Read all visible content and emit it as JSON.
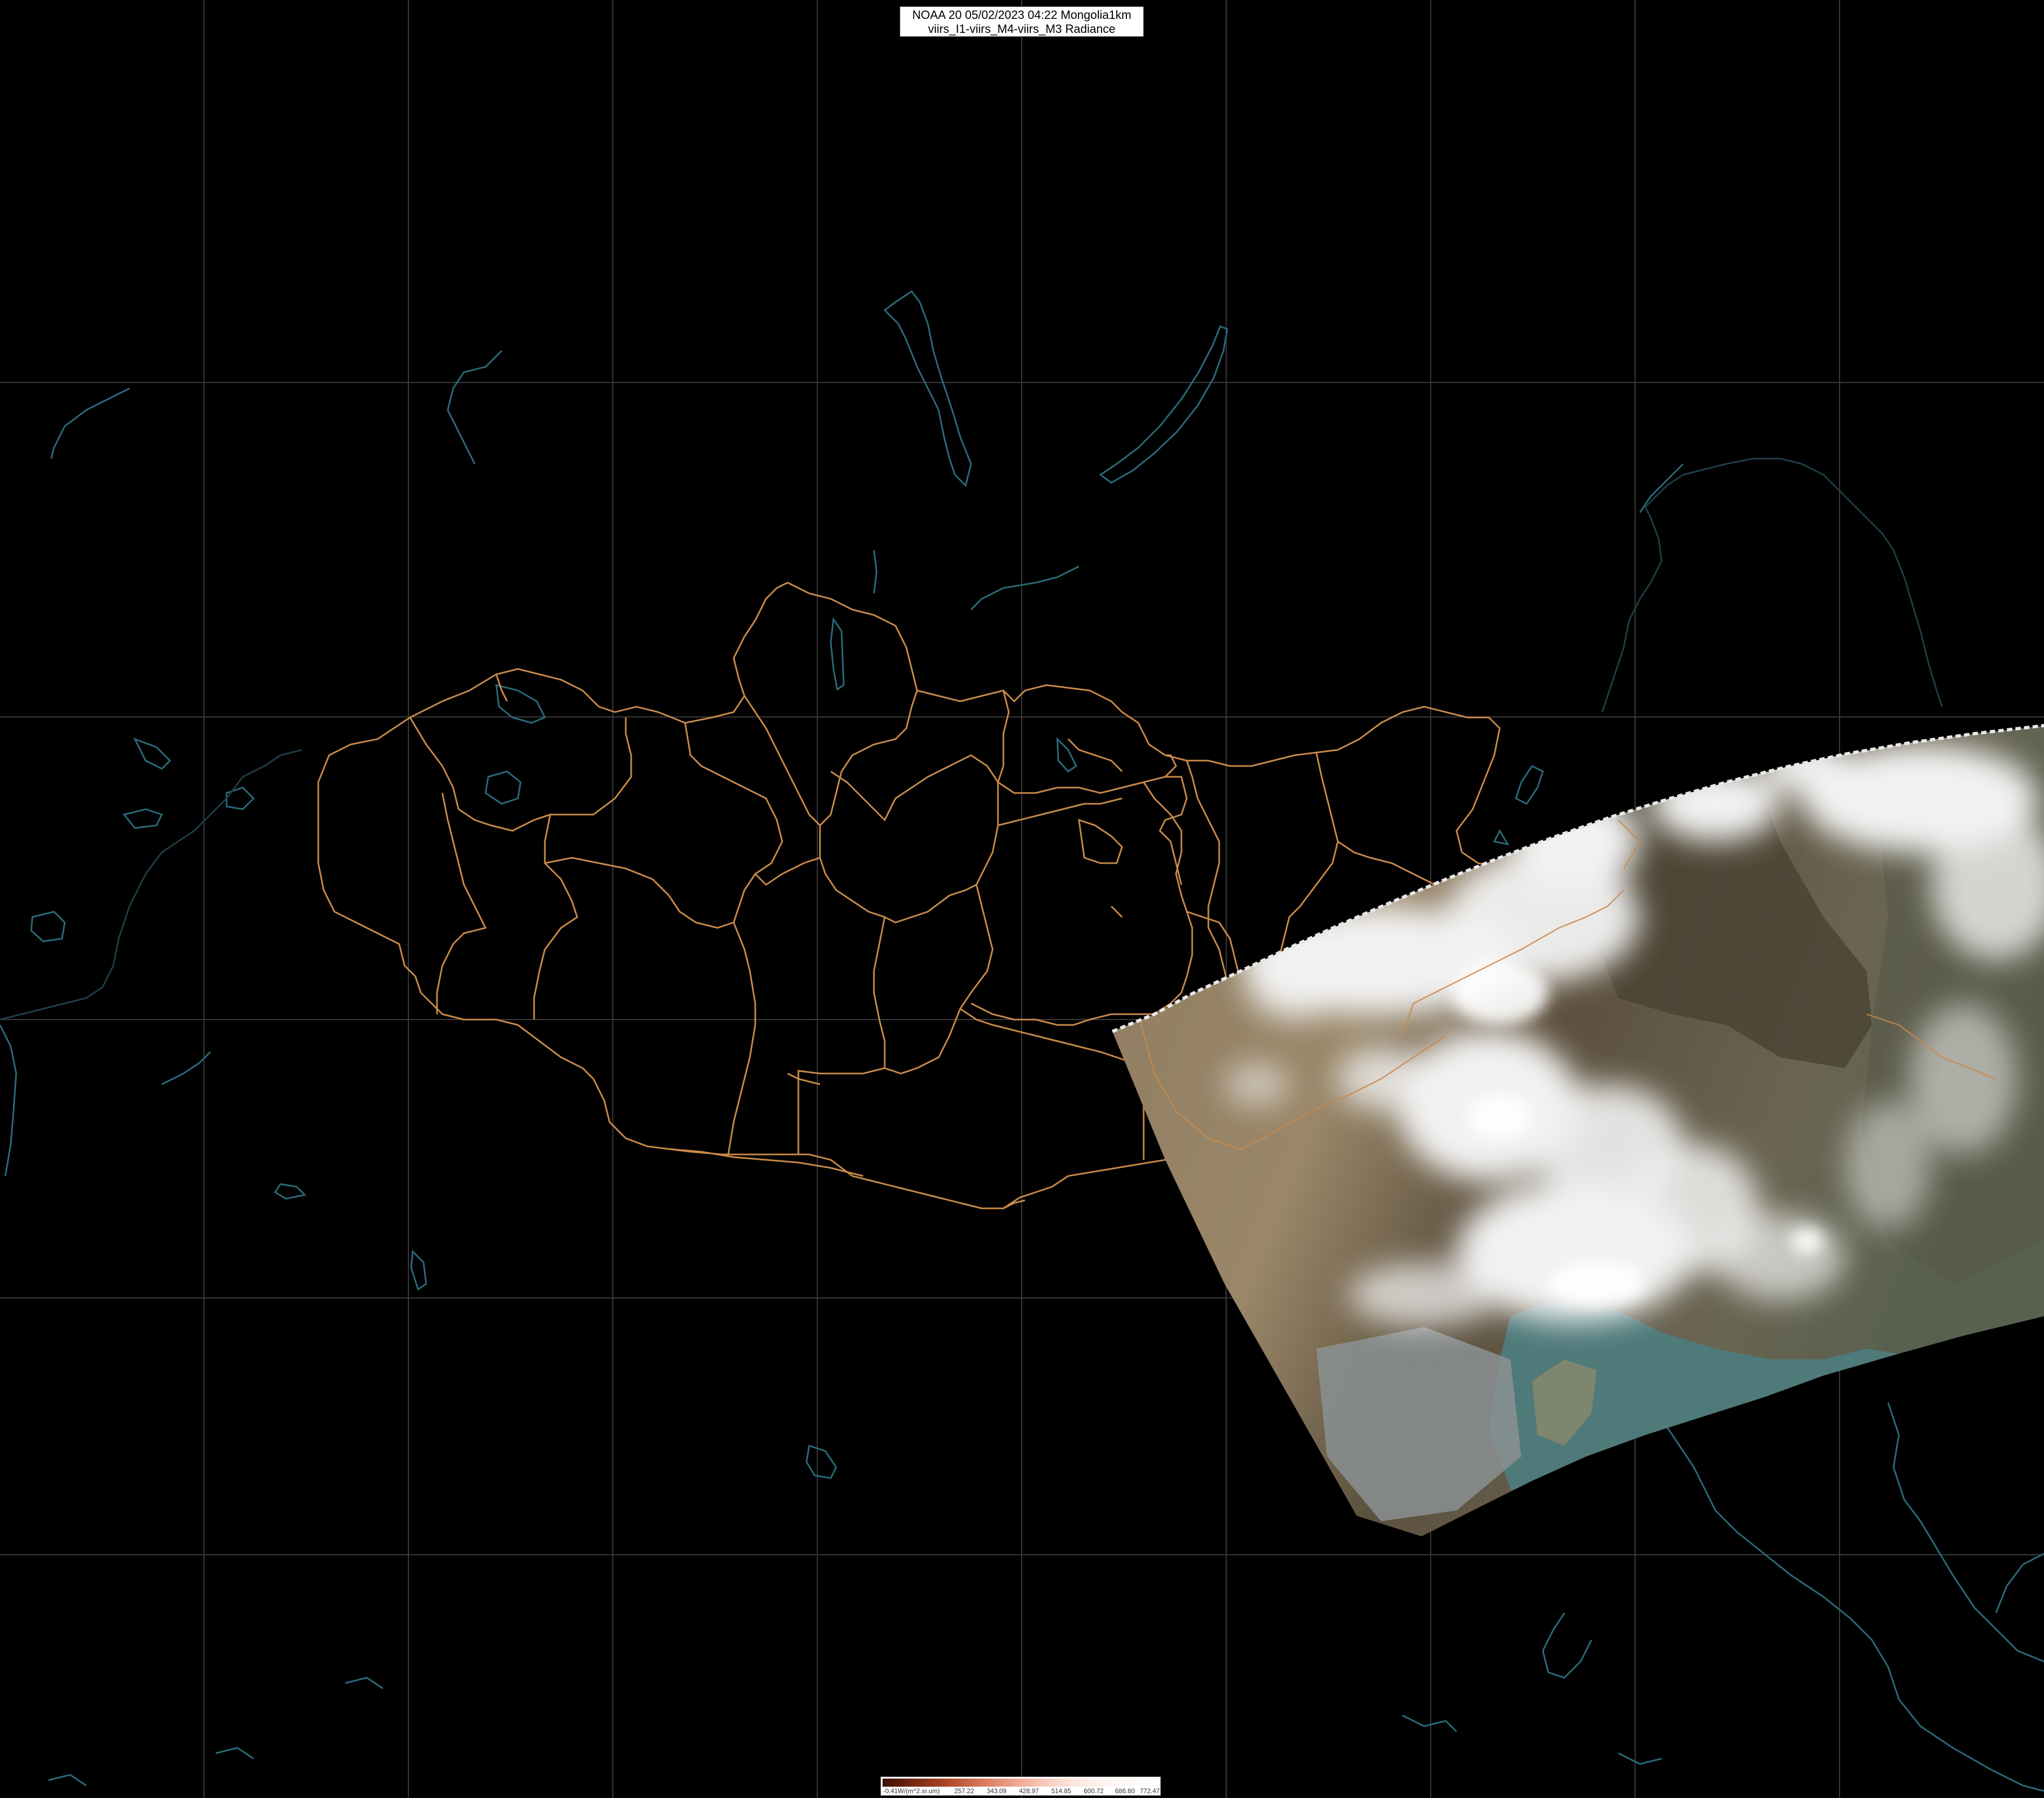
{
  "header": {
    "line1": "NOAA 20 05/02/2023 04:22 Mongolia1km",
    "line2": "viirs_I1-viirs_M4-viirs_M3 Radiance"
  },
  "colorbar": {
    "unit_label": "-0.41W/(m^2.sr.um)",
    "ticks": [
      "257.22",
      "343.09",
      "428.97",
      "514.85",
      "600.72",
      "686.60",
      "772.47"
    ]
  },
  "colors": {
    "background": "#000000",
    "graticule": "#3a3a3a",
    "admin_borders": "#c98a4a",
    "coast_water": "#2b6a7a"
  },
  "layers": [
    "graticule",
    "lakes-and-rivers",
    "province-borders",
    "satellite-swath"
  ]
}
